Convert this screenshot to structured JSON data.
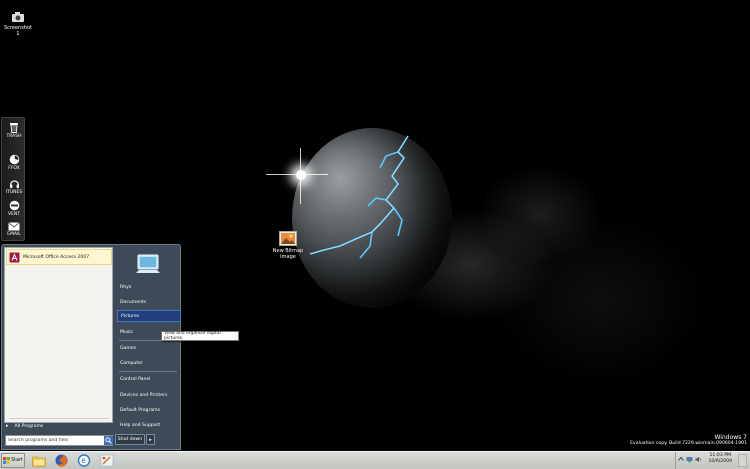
{
  "desktop": {
    "icons": [
      {
        "label": "Screenshot 1",
        "icon": "camera-icon"
      },
      {
        "label": "New Bitmap Image",
        "icon": "bitmap-image-icon"
      }
    ]
  },
  "dock": {
    "items": [
      {
        "label": "TRASH",
        "icon": "trash-icon"
      },
      {
        "label": "FFOX",
        "icon": "firefox-icon"
      },
      {
        "label": "ITUNES",
        "icon": "headphones-icon"
      },
      {
        "label": "VENT",
        "icon": "ventrilo-icon"
      },
      {
        "label": "EMAIL",
        "icon": "mail-icon"
      }
    ]
  },
  "start_menu": {
    "pinned_program": "Microsoft Office Access 2007",
    "all_programs": "All Programs",
    "search_placeholder": "Search programs and files",
    "right_links": [
      "Rhys",
      "Documents",
      "Pictures",
      "Music",
      "Games",
      "Computer",
      "Control Panel",
      "Devices and Printers",
      "Default Programs",
      "Help and Support"
    ],
    "highlighted_link": "Pictures",
    "tooltip": "View and organize digital pictures.",
    "shutdown_label": "Shut down",
    "shutdown_arrow": "▸"
  },
  "watermark": {
    "os": "Windows 7",
    "build": "Evaluation copy. Build 7229.winmain.090604-1901"
  },
  "taskbar": {
    "start_label": "Start",
    "pinned": [
      {
        "icon": "explorer-folder-icon"
      },
      {
        "icon": "firefox-icon"
      },
      {
        "icon": "ie-icon"
      },
      {
        "icon": "paint-icon"
      }
    ],
    "clock_time": "11:03 PM",
    "clock_date": "10/6/2009"
  },
  "colors": {
    "start_menu_bg": "#3d4a57",
    "highlight": "#1f3e7a",
    "taskbar": "#c8cac5"
  }
}
